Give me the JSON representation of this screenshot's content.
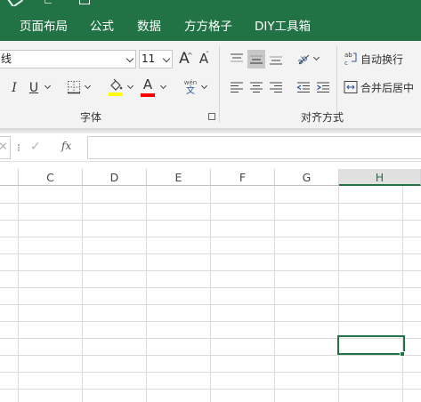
{
  "tabs": [
    {
      "label": "页面布局"
    },
    {
      "label": "公式"
    },
    {
      "label": "数据"
    },
    {
      "label": "方方格子"
    },
    {
      "label": "DIY工具箱"
    }
  ],
  "font": {
    "name_value": "线",
    "size_value": "11",
    "grow_label": "A",
    "shrink_label": "A",
    "italic_label": "I",
    "underline_label": "U",
    "font_color_label": "A",
    "phonetic_top": "wén",
    "phonetic_bottom": "文",
    "group_label": "字体"
  },
  "alignment": {
    "wrap_text_label": "自动换行",
    "merge_center_label": "合并后居中",
    "group_label": "对齐方式",
    "wrap_icon_text": "ab"
  },
  "formula_bar": {
    "cancel_symbol": "✕",
    "enter_symbol": "✓",
    "fx_label": "fx",
    "formula_value": ""
  },
  "columns": [
    "C",
    "D",
    "E",
    "F",
    "G",
    "H"
  ],
  "selected_column": "H",
  "colors": {
    "accent": "#217346",
    "ribbon": "#f3f3f3",
    "highlight": "#ffff00",
    "font_color": "#ff0000"
  }
}
